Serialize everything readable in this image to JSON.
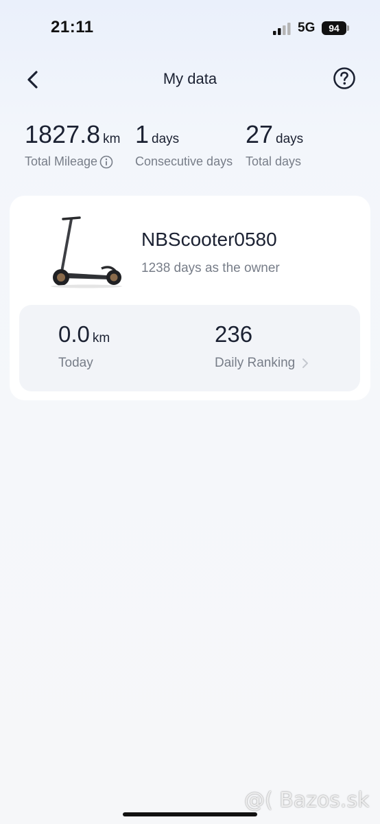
{
  "status_bar": {
    "time": "21:11",
    "network": "5G",
    "battery": "94"
  },
  "header": {
    "title": "My data",
    "back_icon": "chevron-left-icon",
    "help_icon": "question-circle-icon"
  },
  "stats": {
    "total_mileage": {
      "value": "1827.8",
      "unit": "km",
      "label": "Total Mileage"
    },
    "consecutive_days": {
      "value": "1",
      "unit": "days",
      "label": "Consecutive days"
    },
    "total_days": {
      "value": "27",
      "unit": "days",
      "label": "Total days"
    }
  },
  "device": {
    "name": "NBScooter0580",
    "owner_days": "1238 days as the owner",
    "image_icon": "scooter-image"
  },
  "panel": {
    "today": {
      "value": "0.0",
      "unit": "km",
      "label": "Today"
    },
    "ranking": {
      "value": "236",
      "label": "Daily Ranking"
    }
  },
  "watermark": "@( Bazos.sk",
  "colors": {
    "primary_text": "#1b2132",
    "secondary_text": "#777d88",
    "card_bg": "#ffffff",
    "panel_bg": "#f2f4f8"
  }
}
